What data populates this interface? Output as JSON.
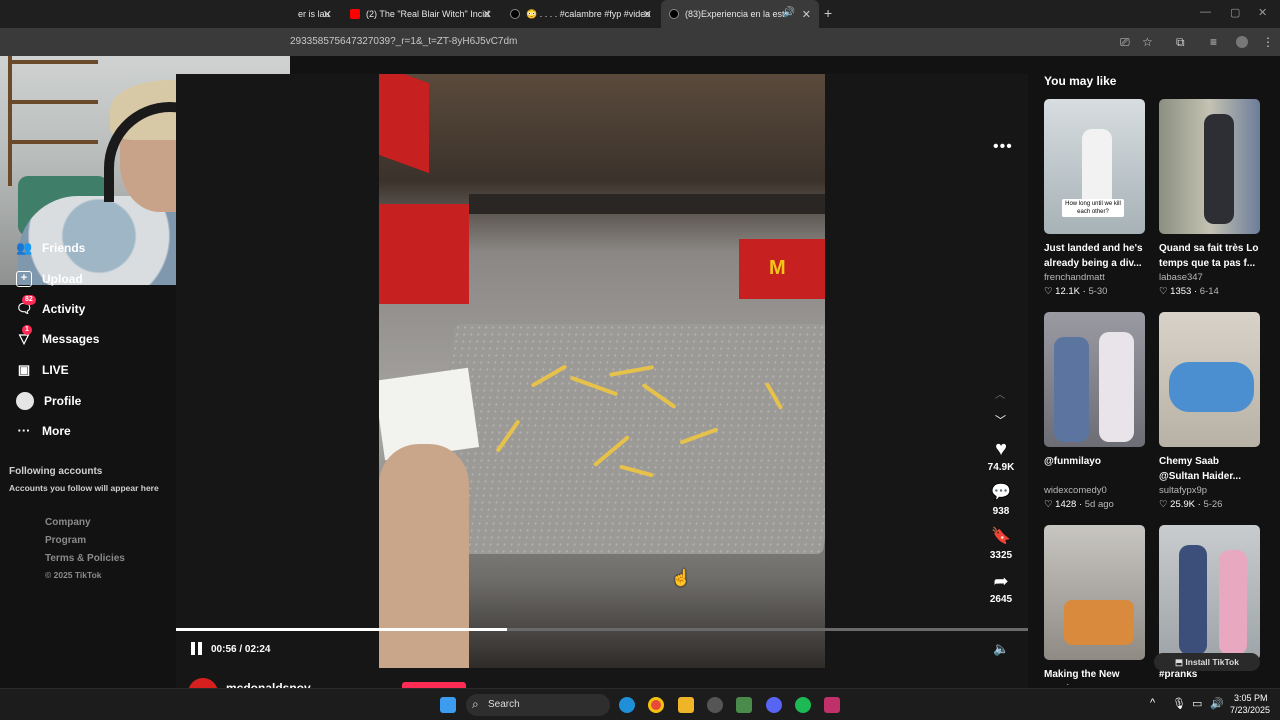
{
  "browser": {
    "tabs": [
      {
        "label": "er is lau",
        "active": false
      },
      {
        "label": "(2) The \"Real Blair Witch\" Incid",
        "active": false
      },
      {
        "label": "😳 . . . . #calambre #fyp #video",
        "active": false
      },
      {
        "label": "(83)Experiencia en la estaci",
        "active": true
      }
    ],
    "new_tab": "+",
    "url": "293358575647327039?_r=1&_t=ZT-8yH6J5vC7dm"
  },
  "sidebar": {
    "items": [
      {
        "label": "Friends",
        "icon": "friends-icon"
      },
      {
        "label": "Upload",
        "icon": "upload-icon"
      },
      {
        "label": "Activity",
        "icon": "activity-icon",
        "badge": "82"
      },
      {
        "label": "Messages",
        "icon": "messages-icon",
        "badge": "1"
      },
      {
        "label": "LIVE",
        "icon": "live-icon"
      },
      {
        "label": "Profile",
        "icon": "profile-icon"
      },
      {
        "label": "More",
        "icon": "more-icon"
      }
    ],
    "following_title": "Following accounts",
    "following_sub": "Accounts you follow will appear here",
    "footer_links": [
      "Company",
      "Program",
      "Terms & Policies"
    ],
    "copyright": "© 2025 TikTok"
  },
  "player": {
    "time": "00:56 / 02:24",
    "progress": 0.389,
    "author": "mcdonaldsnov",
    "actions": [
      {
        "icon": "heart-icon",
        "count": "74.9K"
      },
      {
        "icon": "comment-icon",
        "count": "938"
      },
      {
        "icon": "bookmark-icon",
        "count": "3325"
      },
      {
        "icon": "share-icon",
        "count": "2645"
      }
    ]
  },
  "rail": {
    "title": "You may like",
    "cards": [
      {
        "title": "Just landed and he's already being a div...",
        "author": "frenchandmatt",
        "likes": "12.1K",
        "date": "5-30",
        "caption": "How long until we kill each other?",
        "thumb": "#b7c2c8"
      },
      {
        "title": "Quand sa fait très Lo temps que ta pas f...",
        "author": "labase347",
        "likes": "1353",
        "date": "6-14",
        "caption": "",
        "thumb": "#9a9e8c"
      },
      {
        "title": "@funmilayo",
        "author": "widexcomedy0",
        "likes": "1428",
        "date": "5d ago",
        "caption": "",
        "thumb": "#8b8a93"
      },
      {
        "title": "Chemy Saab @Sultan Haider...",
        "author": "sultafypx9p",
        "likes": "25.9K",
        "date": "5-26",
        "caption": "",
        "thumb": "#c7c2b9"
      },
      {
        "title": "Making the New Hershey Smores...",
        "author": "",
        "likes": "",
        "date": "",
        "caption": "",
        "thumb": "#a5a29d"
      },
      {
        "title": "#pranks",
        "author": "",
        "likes": "",
        "date": "",
        "caption": "",
        "thumb": "#b5b9bb"
      }
    ],
    "install": "Install TikTok"
  },
  "taskbar": {
    "search": "Search",
    "time": "3:05 PM",
    "date": "7/23/2025"
  }
}
